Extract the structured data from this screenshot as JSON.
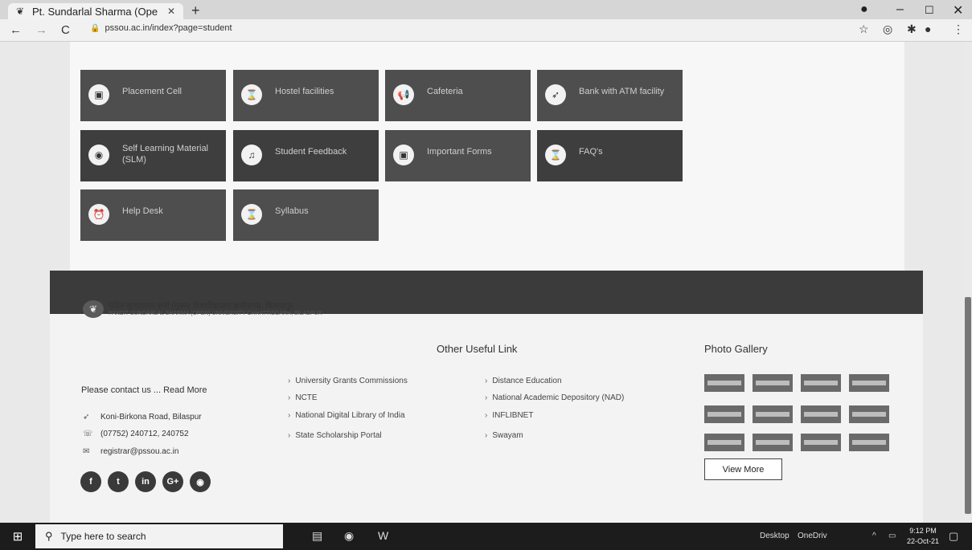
{
  "browser": {
    "tab_title": "Pt. Sundarlal Sharma (Ope",
    "url": "pssou.ac.in/index?page=student"
  },
  "tiles": [
    {
      "label": "Placement Cell",
      "icon": "clipboard-icon"
    },
    {
      "label": "Hostel facilities",
      "icon": "hourglass-icon"
    },
    {
      "label": "Cafeteria",
      "icon": "megaphone-icon"
    },
    {
      "label": "Bank with ATM facility",
      "icon": "rocket-icon"
    },
    {
      "label": "Self Learning Material (SLM)",
      "icon": "globe-icon"
    },
    {
      "label": "Student Feedback",
      "icon": "music-icon"
    },
    {
      "label": "Important Forms",
      "icon": "clipboard-icon"
    },
    {
      "label": "FAQ's",
      "icon": "hourglass-icon"
    },
    {
      "label": "Help Desk",
      "icon": "alarm-icon"
    },
    {
      "label": "Syllabus",
      "icon": "hourglass-icon"
    }
  ],
  "footer": {
    "logo_text": "पंडित सुन्दरलाल शर्मा (मुक्त) विश्वविद्यालय छत्तीसगढ़, बिलासपुर",
    "logo_sub": "PANDIT SUNDARLAL SHARMA (OPEN) UNIVERSITY CHHATTISGARH, BILASPUR",
    "contact_prompt": "Please contact us ... Read More",
    "address": "Koni-Birkona Road, Bilaspur",
    "phone": "(07752) 240712, 240752",
    "email": "registrar@pssou.ac.in",
    "useful_title": "Other Useful Link",
    "links_col1": [
      "University Grants Commissions",
      "NCTE",
      "National Digital Library of India",
      "State Scholarship Portal"
    ],
    "links_col2": [
      "Distance Education",
      "National Academic Depository (NAD)",
      "INFLIBNET",
      "Swayam"
    ],
    "gallery_title": "Photo Gallery",
    "view_more": "View More"
  },
  "taskbar": {
    "search_placeholder": "Type here to search",
    "desktop_label": "Desktop",
    "onedrive_label": "OneDriv",
    "time": "9:12 PM",
    "date": "22-Oct-21"
  }
}
